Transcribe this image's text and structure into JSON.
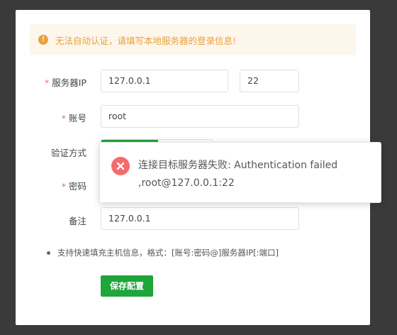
{
  "alert": {
    "icon": "warning-circle-icon",
    "text": "无法自动认证，请填写本地服务器的登录信息!",
    "color": "#e6a23c"
  },
  "form": {
    "server_ip": {
      "label": "服务器IP",
      "value": "127.0.0.1",
      "required": true
    },
    "port": {
      "value": "22"
    },
    "account": {
      "label": "账号",
      "value": "root",
      "required": true
    },
    "auth_method": {
      "label": "验证方式"
    },
    "password": {
      "label": "密码",
      "required": true
    },
    "remark": {
      "label": "备注",
      "value": "127.0.0.1"
    },
    "required_mark": "*"
  },
  "tip": "支持快速填充主机信息，格式：[账号:密码@]服务器IP[:端口]",
  "save_button": "保存配置",
  "toast": {
    "icon": "error-circle-icon",
    "line1": "连接目标服务器失败: Authentication failed",
    "line2": ",root@127.0.0.1:22"
  },
  "colors": {
    "accent": "#20a53a",
    "error": "#f56c6c",
    "warning": "#e6a23c"
  }
}
